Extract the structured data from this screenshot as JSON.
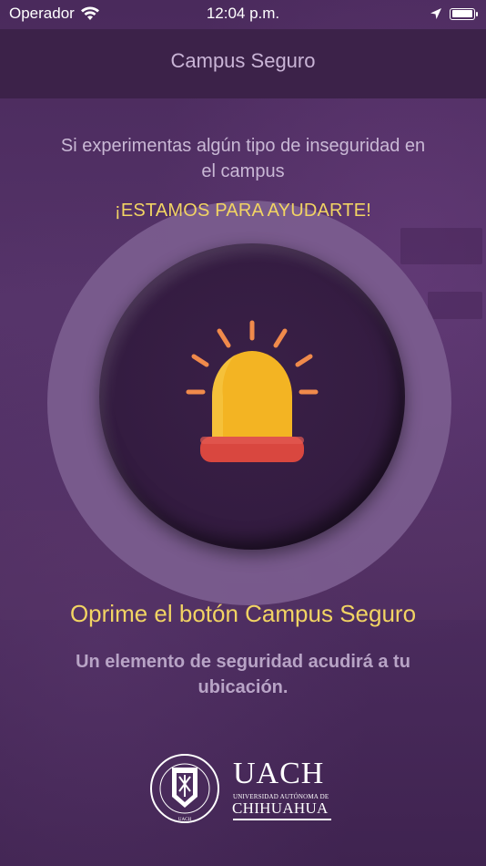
{
  "status_bar": {
    "carrier": "Operador",
    "time": "12:04 p.m.",
    "battery_level": 1.0
  },
  "nav": {
    "title": "Campus Seguro"
  },
  "main": {
    "intro": "Si experimentas algún tipo de inseguridad en el campus",
    "help_message": "¡ESTAMOS PARA AYUDARTE!",
    "cta": "Oprime el botón Campus Seguro",
    "info": "Un elemento de seguridad acudirá a tu ubicación."
  },
  "logo": {
    "name": "UACH",
    "subtitle": "UNIVERSIDAD AUTÓNOMA DE",
    "city": "CHIHUAHUA",
    "seal_text": "UNIVERSIDAD AUTÓNOMA DE CHIHUAHUA"
  },
  "icons": {
    "wifi": "wifi-icon",
    "location": "location-arrow-icon",
    "battery": "battery-icon",
    "siren": "siren-icon",
    "seal": "uach-seal-icon"
  },
  "colors": {
    "background": "#4d2d60",
    "nav_bar": "#3c2249",
    "accent_yellow": "#f2d463",
    "ring": "#7c5e90",
    "button": "#341c41",
    "siren_dome": "#f3b423",
    "siren_base": "#d9473f",
    "siren_rays": "#f08a4b"
  }
}
